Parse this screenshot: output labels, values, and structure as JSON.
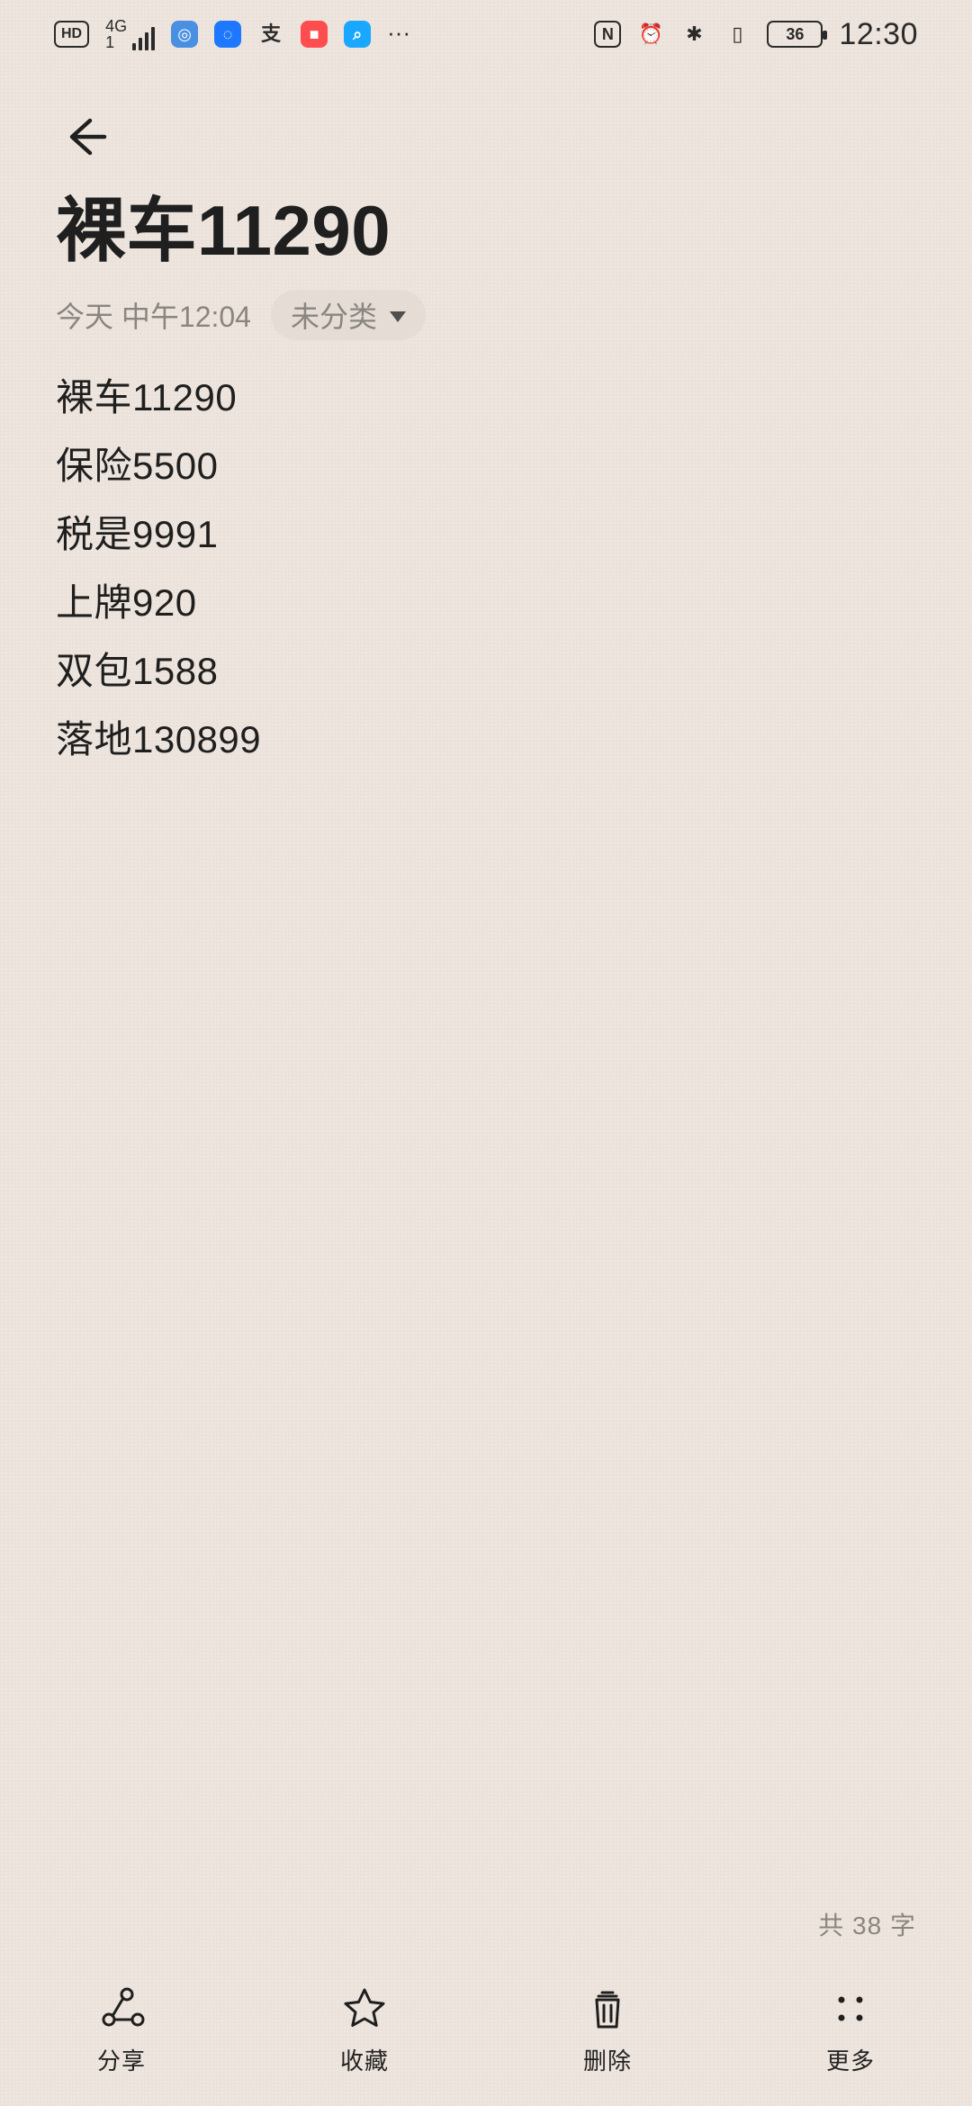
{
  "status_bar": {
    "left": {
      "hd_badge": "HD",
      "network": "4G",
      "network_sub": "1",
      "app_icons": [
        {
          "icon": "browser-icon",
          "color": "#4a90e2",
          "glyph": "◎"
        },
        {
          "icon": "bulb-icon",
          "color": "#1e78ff",
          "glyph": "◌"
        },
        {
          "icon": "alipay-icon",
          "color": "transparent",
          "glyph": "支"
        },
        {
          "icon": "red-app-icon",
          "color": "#ff4d4f",
          "glyph": "■"
        },
        {
          "icon": "search-app-icon",
          "color": "#1aa7ff",
          "glyph": "⌕"
        }
      ],
      "more": "···"
    },
    "right": {
      "nfc": "N",
      "battery": "36",
      "time": "12:30"
    }
  },
  "note": {
    "title": "裸车11290",
    "time": "今天 中午12:04",
    "category": "未分类",
    "lines": [
      "裸车11290",
      "保险5500",
      "税是9991",
      "上牌920",
      "双包1588",
      "落地130899"
    ],
    "char_count": "共 38 字"
  },
  "toolbar": {
    "items": [
      {
        "label": "分享",
        "icon": "share-icon"
      },
      {
        "label": "收藏",
        "icon": "star-icon"
      },
      {
        "label": "删除",
        "icon": "trash-icon"
      },
      {
        "label": "更多",
        "icon": "more-icon"
      }
    ]
  }
}
